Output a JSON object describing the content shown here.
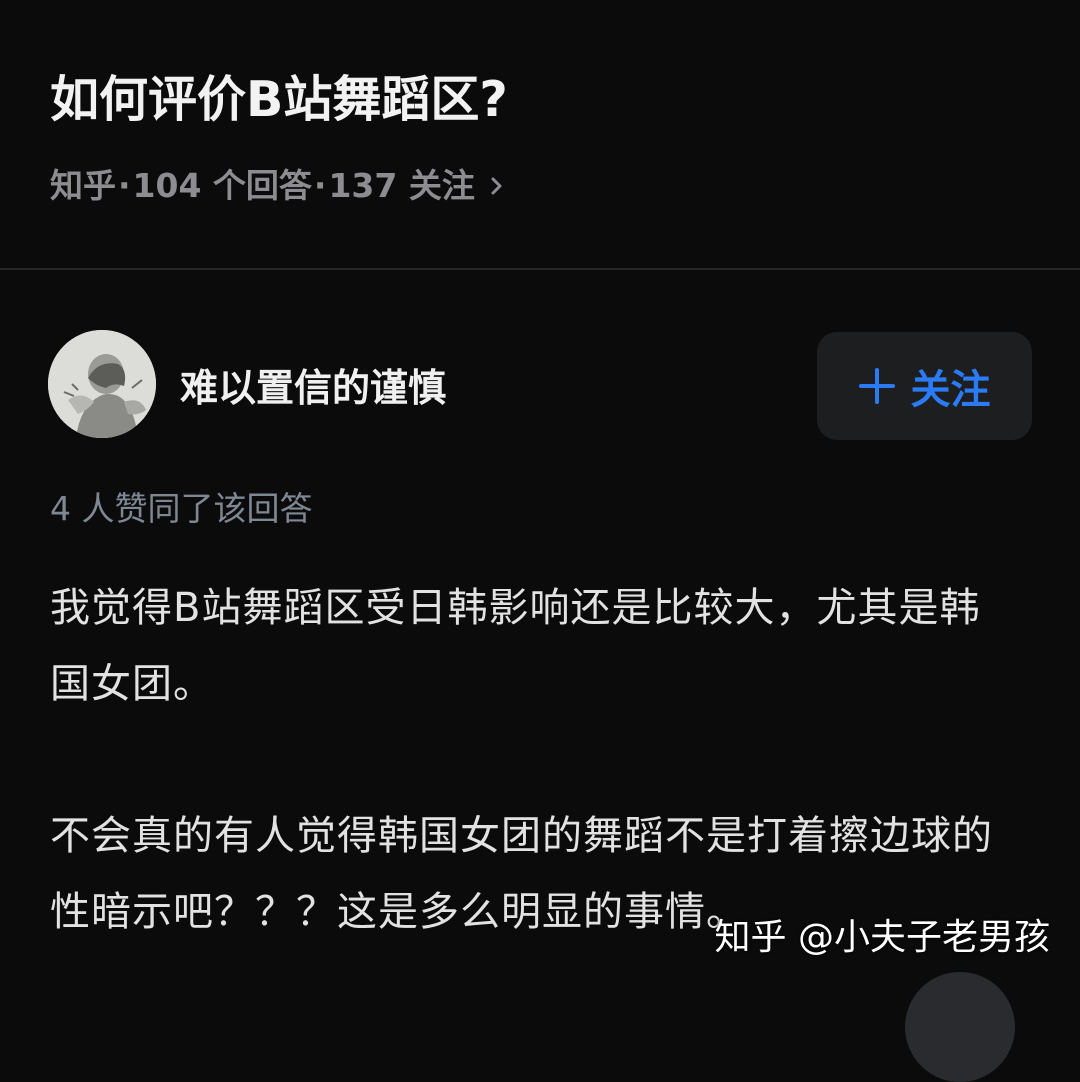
{
  "question": {
    "title": "如何评价B站舞蹈区?",
    "meta": {
      "source": "知乎",
      "answers": "104 个回答",
      "followers": "137 关注",
      "separator": "·"
    }
  },
  "author": {
    "name": "难以置信的谨慎",
    "follow_label": "关注"
  },
  "answer": {
    "vote_summary": "4 人赞同了该回答",
    "paragraphs": [
      "我觉得B站舞蹈区受日韩影响还是比较大，尤其是韩国女团。",
      "不会真的有人觉得韩国女团的舞蹈不是打着擦边球的性暗示吧？？？这是多么明显的事情。"
    ]
  },
  "watermark": {
    "text": "知乎 @小夫子老男孩"
  },
  "colors": {
    "background": "#0b0b0c",
    "accent": "#2b7bf6",
    "meta_text": "#8d8d91",
    "vote_text": "#7f8794",
    "follow_button_bg": "#1d1e20"
  },
  "icons": {
    "meta_chevron": "chevron-right-icon",
    "follow_plus": "plus-icon"
  }
}
